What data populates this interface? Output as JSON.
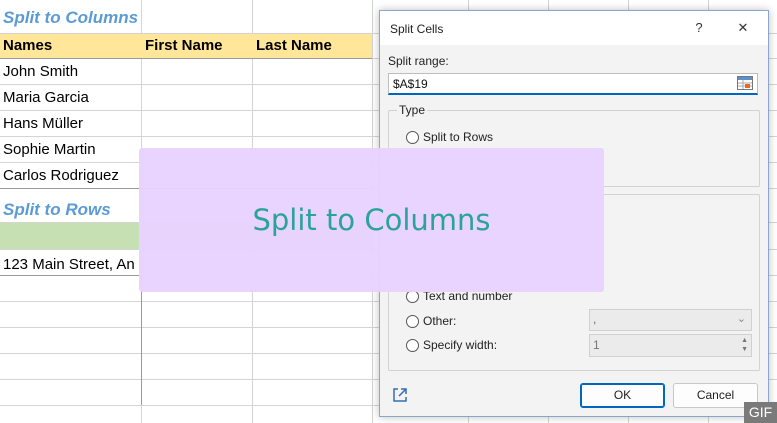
{
  "sheet": {
    "section1_title": "Split to Columns",
    "headers": [
      "Names",
      "First Name",
      "Last Name"
    ],
    "names": [
      "John Smith",
      "Maria Garcia",
      "Hans Müller",
      "Sophie Martin",
      "Carlos Rodriguez"
    ],
    "section2_title": "Split to Rows",
    "row2_text": "123 Main Street, An",
    "header_fill_color": "#ffe699",
    "row_band_color": "#c6e0b4"
  },
  "dialog": {
    "title": "Split Cells",
    "help_label": "?",
    "close_label": "✕",
    "split_range_label": "Split range:",
    "split_range_value": "$A$19",
    "type_group_label": "Type",
    "type_options": [
      "Split to Rows"
    ],
    "split_options": [
      "Text and number",
      "Other:",
      "Specify width:"
    ],
    "other_value": ",",
    "width_value": "1",
    "ok_label": "OK",
    "cancel_label": "Cancel"
  },
  "overlay": {
    "text": "Split to Columns",
    "color": "#2aa39a"
  },
  "badge": {
    "text": "GIF"
  }
}
